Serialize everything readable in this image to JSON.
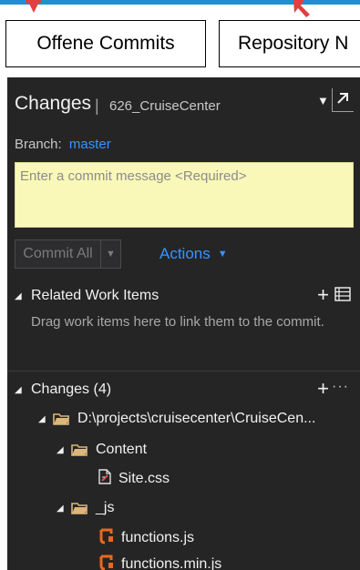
{
  "annotations": {
    "callout_1": "Offene Commits",
    "callout_2": "Repository N"
  },
  "colors": {
    "panel_bg": "#252526",
    "accent_blue": "#3794ff",
    "commit_box_bg": "#f9f8b8",
    "js_file_orange": "#e8691d",
    "folder_color": "#dcb67a"
  },
  "header": {
    "title": "Changes",
    "separator": "|",
    "repo": "626_CruiseCenter"
  },
  "branch": {
    "label": "Branch:",
    "name": "master"
  },
  "commit": {
    "placeholder": "Enter a commit message <Required>",
    "commit_all_label": "Commit All",
    "actions_label": "Actions"
  },
  "related_work_items": {
    "title": "Related Work Items",
    "description": "Drag work items here to link them to the commit."
  },
  "changes": {
    "title": "Changes (4)",
    "tree": [
      {
        "label": "D:\\projects\\cruisecenter\\CruiseCen...",
        "kind": "folder",
        "level": 0
      },
      {
        "label": "Content",
        "kind": "folder",
        "level": 1
      },
      {
        "label": "Site.css",
        "kind": "css-file",
        "level": 2
      },
      {
        "label": "_js",
        "kind": "folder",
        "level": 1
      },
      {
        "label": "functions.js",
        "kind": "js-file",
        "level": 2
      },
      {
        "label": "functions.min.js",
        "kind": "js-file",
        "level": 2
      }
    ]
  }
}
